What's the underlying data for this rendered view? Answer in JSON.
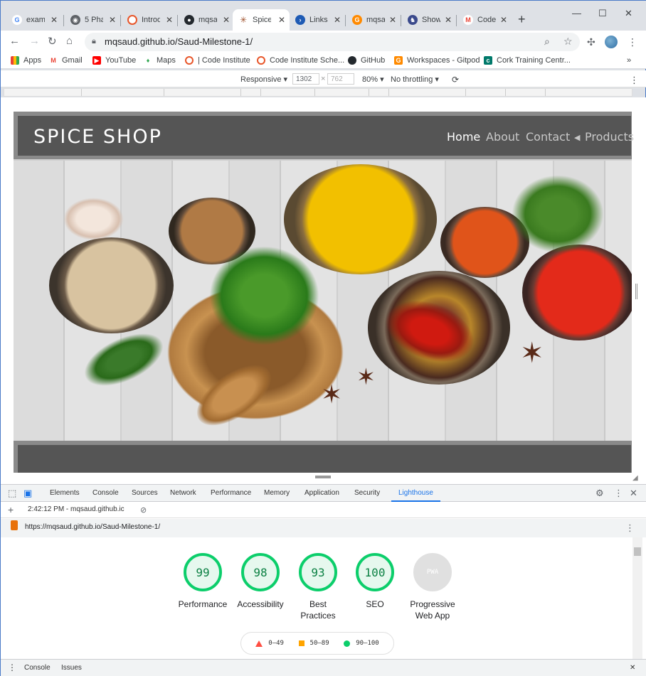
{
  "browser": {
    "tabs": [
      {
        "label": "exam",
        "icon": "google-icon",
        "color": "#4285f4",
        "glyph": "G"
      },
      {
        "label": "5 Pha",
        "icon": "globe-icon",
        "color": "#5f6368",
        "glyph": "◉"
      },
      {
        "label": "Introd",
        "icon": "code-institute-icon",
        "color": "#e8562a",
        "glyph": "○"
      },
      {
        "label": "mqsa",
        "icon": "github-icon",
        "color": "#24292e",
        "glyph": "●"
      },
      {
        "label": "Spice",
        "icon": "spice-icon",
        "color": "#a0522d",
        "glyph": "✳"
      },
      {
        "label": "Links",
        "icon": "powershell-icon",
        "color": "#1e5ab4",
        "glyph": "›"
      },
      {
        "label": "mqsa",
        "icon": "gitpod-icon",
        "color": "#ff8a00",
        "glyph": "G"
      },
      {
        "label": "Show",
        "icon": "netlify-icon",
        "color": "#3b4a8c",
        "glyph": "♞"
      },
      {
        "label": "Code",
        "icon": "gmail-icon",
        "color": "#ea4335",
        "glyph": "M"
      }
    ],
    "active_tab": 4,
    "url": "mqsaud.github.io/Saud-Milestone-1/",
    "bookmarks": [
      {
        "label": "Apps",
        "icon": "apps-grid-icon",
        "color": "#ea4335"
      },
      {
        "label": "Gmail",
        "icon": "gmail-icon",
        "color": "#ea4335"
      },
      {
        "label": "YouTube",
        "icon": "youtube-icon",
        "color": "#ff0000"
      },
      {
        "label": "Maps",
        "icon": "maps-pin-icon",
        "color": "#34a853"
      },
      {
        "label": "| Code Institute",
        "icon": "code-institute-icon",
        "color": "#e8562a"
      },
      {
        "label": "Code Institute Sche...",
        "icon": "code-institute-icon",
        "color": "#e8562a"
      },
      {
        "label": "GitHub",
        "icon": "github-icon",
        "color": "#24292e"
      },
      {
        "label": "Workspaces - Gitpod",
        "icon": "gitpod-icon",
        "color": "#ff8a00"
      },
      {
        "label": "Cork Training Centr...",
        "icon": "cork-training-icon",
        "color": "#00796b"
      }
    ],
    "more_bookmarks": "»"
  },
  "device_toolbar": {
    "mode": "Responsive",
    "width": "1302",
    "height": "762",
    "zoom": "80%",
    "throttling": "No throttling"
  },
  "site": {
    "brand": "SPICE SHOP",
    "nav": [
      "Home",
      "About",
      "Contact",
      "Products"
    ],
    "current_nav": "Home",
    "hero_image": "spices-in-bowls-photo"
  },
  "devtools": {
    "tabs": [
      "Elements",
      "Console",
      "Sources",
      "Network",
      "Performance",
      "Memory",
      "Application",
      "Security",
      "Lighthouse"
    ],
    "active_tab": "Lighthouse",
    "report_time": "2:42:12 PM - mqsaud.github.ic",
    "report_url": "https://mqsaud.github.io/Saud-Milestone-1/",
    "scores": [
      {
        "label": "Performance",
        "value": "99",
        "color": "#0cce6b"
      },
      {
        "label": "Accessibility",
        "value": "98",
        "color": "#0cce6b"
      },
      {
        "label": "Best Practices",
        "value": "93",
        "color": "#0cce6b"
      },
      {
        "label": "SEO",
        "value": "100",
        "color": "#0cce6b"
      },
      {
        "label": "Progressive Web App",
        "value": "PWA",
        "color": "#e0e0e0"
      }
    ],
    "legend": [
      {
        "range": "0–49",
        "color": "#ff4e42"
      },
      {
        "range": "50–89",
        "color": "#ffa400"
      },
      {
        "range": "90–100",
        "color": "#0cce6b"
      }
    ],
    "drawer_tabs": [
      "Console",
      "Issues"
    ]
  }
}
